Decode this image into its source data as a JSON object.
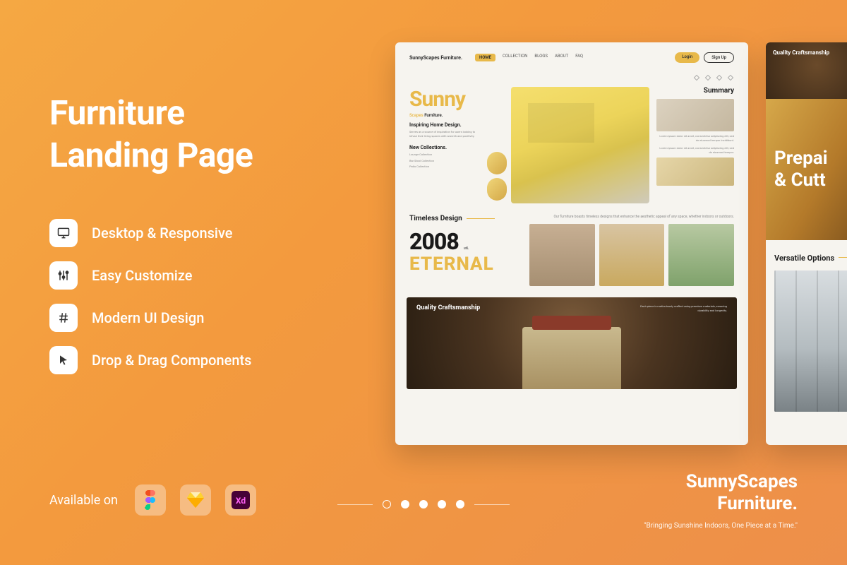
{
  "promo": {
    "title_line1": "Furniture",
    "title_line2": "Landing Page",
    "features": [
      {
        "icon": "monitor-icon",
        "label": "Desktop & Responsive"
      },
      {
        "icon": "sliders-icon",
        "label": "Easy Customize"
      },
      {
        "icon": "hash-icon",
        "label": "Modern UI Design"
      },
      {
        "icon": "cursor-icon",
        "label": "Drop & Drag Components"
      }
    ],
    "available_label": "Available on",
    "tools": [
      "figma",
      "sketch",
      "xd"
    ]
  },
  "pager": {
    "count": 5,
    "active_index": 0
  },
  "brand": {
    "name_line1": "SunnyScapes",
    "name_line2": "Furniture.",
    "tagline": "\"Bringing Sunshine Indoors, One Piece at a Time.\""
  },
  "mock1": {
    "logo": "SunnyScapes Furniture.",
    "nav": [
      "HOME",
      "COLLECTION",
      "BLOGS",
      "ABOUT",
      "FAQ"
    ],
    "nav_active": "HOME",
    "login": "Login",
    "signup": "Sign Up",
    "hero_word": "Sunny",
    "hero_sub_scapes": "Scapes",
    "hero_sub_furniture": "Furniture.",
    "inspiring": "Inspiring Home Design.",
    "inspiring_body": "Serves as a source of inspiration for users looking to infuse their living spaces with warmth and positivity.",
    "new_collections": "New Collections.",
    "collections": [
      "Lounge Collection",
      "Bar Stool Collection",
      "Patio Collection"
    ],
    "summary_title": "Summary",
    "summary_p1": "Lorem ipsum dolor sit amet, consectetur adipiscing elit, sed do eiusmod tempor incididunt.",
    "summary_p2": "Lorem ipsum dolor sit amet, consectetur adipiscing elit, sed do eiusmod tempor.",
    "timeless": "Timeless Design",
    "timeless_desc": "Our furniture boasts timeless designs that enhance the aesthetic appeal of any space, whether indoors or outdoors.",
    "year": "2008",
    "until": "until...",
    "eternal": "ETERNAL",
    "banner_title": "Quality Craftsmanship",
    "banner_sub": "Each piece is meticulously crafted using premium materials, ensuring durability and longevity."
  },
  "mock2": {
    "top_title": "Quality Craftsmanship",
    "hero_line1": "Prepai",
    "hero_line2": "& Cutt",
    "section_title": "Versatile Options"
  }
}
